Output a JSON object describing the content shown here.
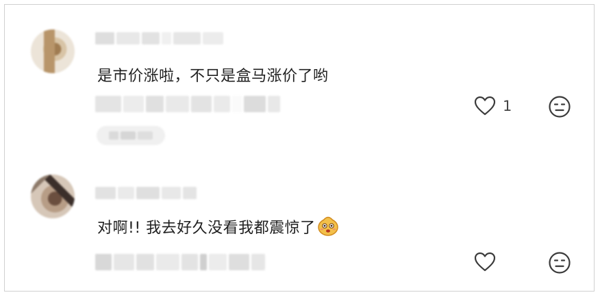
{
  "comments": [
    {
      "text": "是市价涨啦，不只是盒马涨价了哟",
      "like_count": "1"
    },
    {
      "text": "对啊!! 我去好久没看我都震惊了",
      "emoji": "face-emoji",
      "like_count": ""
    }
  ],
  "icons": {
    "like": "heart-outline-icon",
    "dislike": "unamused-face-icon"
  },
  "colors": {
    "text": "#1f1f1f",
    "icon": "#3a3a3a",
    "placeholder": "#e4e4e4",
    "border": "#cfcfcf"
  }
}
